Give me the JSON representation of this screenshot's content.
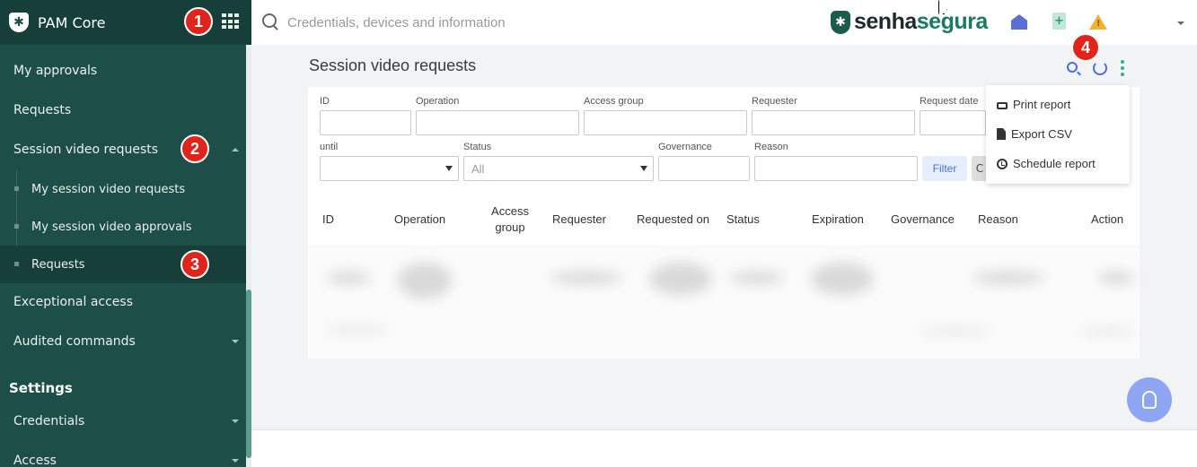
{
  "sidebar": {
    "app_title": "PAM Core",
    "items": [
      {
        "label": "My approvals"
      },
      {
        "label": "Requests"
      },
      {
        "label": "Session video requests"
      },
      {
        "label": "Exceptional access"
      },
      {
        "label": "Audited commands"
      }
    ],
    "sub_items": [
      {
        "label": "My session video requests"
      },
      {
        "label": "My session video approvals"
      },
      {
        "label": "Requests"
      }
    ],
    "settings_heading": "Settings",
    "settings_items": [
      {
        "label": "Credentials"
      },
      {
        "label": "Access"
      }
    ]
  },
  "badges": [
    "1",
    "2",
    "3",
    "4"
  ],
  "topbar": {
    "search_placeholder": "Credentials, devices and information",
    "brand_part1": "senha",
    "brand_part2": "segura",
    "doc_plus": "+",
    "warn_mark": "!"
  },
  "page": {
    "title": "Session video requests"
  },
  "filters": {
    "id_label": "ID",
    "operation_label": "Operation",
    "access_group_label": "Access group",
    "requester_label": "Requester",
    "request_date_label": "Request date",
    "until_label": "until",
    "status_label": "Status",
    "status_value": "All",
    "governance_label": "Governance",
    "reason_label": "Reason",
    "filter_button": "Filter",
    "clear_button": "C"
  },
  "table": {
    "headers": [
      "ID",
      "Operation",
      "Access group",
      "Requester",
      "Requested on",
      "Status",
      "Expiration",
      "Governance",
      "Reason",
      "Action"
    ]
  },
  "menu": {
    "items": [
      {
        "label": "Print report",
        "icon": "printer-icon"
      },
      {
        "label": "Export CSV",
        "icon": "file-icon"
      },
      {
        "label": "Schedule report",
        "icon": "clock-icon"
      }
    ]
  },
  "colors": {
    "sidebar_bg": "#1d4e47",
    "accent_blue": "#4b6ed8",
    "accent_green": "#2eae8a",
    "badge_red": "#e0241b"
  }
}
